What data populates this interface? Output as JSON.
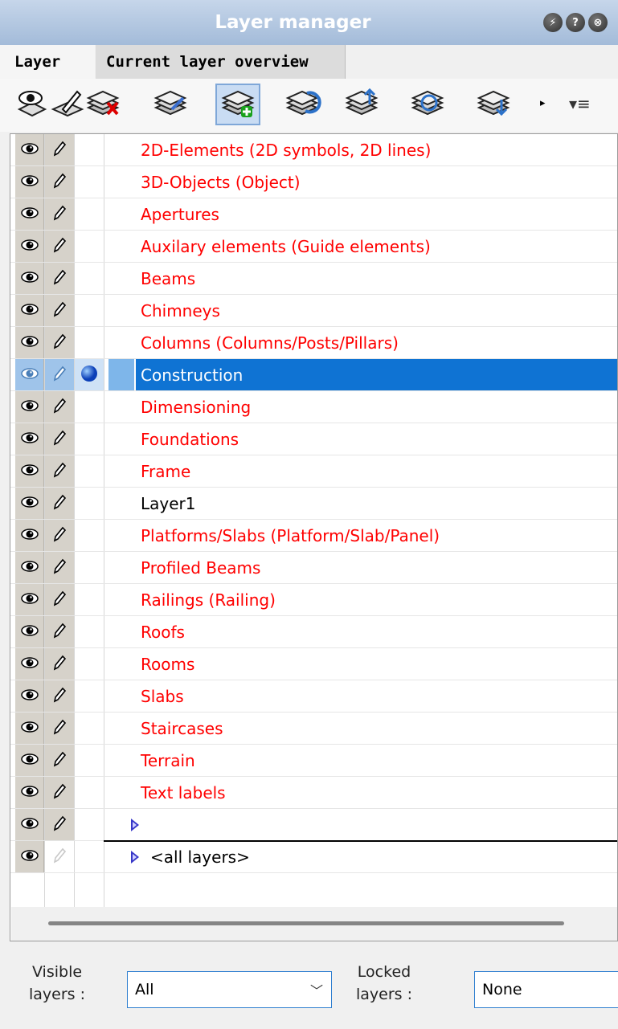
{
  "window": {
    "title": "Layer manager",
    "title_buttons": [
      {
        "name": "pin-button",
        "glyph": "⚡"
      },
      {
        "name": "help-button",
        "glyph": "?"
      },
      {
        "name": "close-button",
        "glyph": "⊗"
      }
    ]
  },
  "tabs": [
    {
      "label": "Layer",
      "active": true
    },
    {
      "label": "Current layer overview",
      "active": false
    }
  ],
  "toolbar": {
    "tools": [
      {
        "name": "show-layer-tool",
        "icon": "eye-icon"
      },
      {
        "name": "edit-layer-tool",
        "icon": "pencil-icon"
      },
      {
        "name": "delete-layer-tool",
        "icon": "delete-layer-icon"
      },
      {
        "name": "edit-properties-tool",
        "icon": "layer-edit-icon"
      },
      {
        "name": "new-layer-tool",
        "icon": "new-layer-icon",
        "selected": true
      },
      {
        "name": "rotate-layer-tool",
        "icon": "layer-rotate-icon"
      },
      {
        "name": "move-up-tool",
        "icon": "layer-up-icon"
      },
      {
        "name": "refresh-layer-tool",
        "icon": "layer-refresh-icon"
      },
      {
        "name": "move-down-tool",
        "icon": "layer-down-icon"
      }
    ],
    "more_glyph": "▸",
    "menu_glyph": "▾≡"
  },
  "layers": [
    {
      "name": "2D-Elements (2D symbols, 2D lines)",
      "color": "#ff0000"
    },
    {
      "name": "3D-Objects (Object)",
      "color": "#ff0000"
    },
    {
      "name": "Apertures",
      "color": "#ff0000"
    },
    {
      "name": "Auxilary elements (Guide elements)",
      "color": "#ff0000"
    },
    {
      "name": "Beams",
      "color": "#ff0000"
    },
    {
      "name": "Chimneys",
      "color": "#ff0000"
    },
    {
      "name": "Columns (Columns/Posts/Pillars)",
      "color": "#ff0000"
    },
    {
      "name": "Construction",
      "color": "#ffffff",
      "selected": true,
      "active": true
    },
    {
      "name": "Dimensioning",
      "color": "#ff0000"
    },
    {
      "name": "Foundations",
      "color": "#ff0000"
    },
    {
      "name": "Frame",
      "color": "#ff0000"
    },
    {
      "name": "Layer1",
      "color": "#000000"
    },
    {
      "name": "Platforms/Slabs (Platform/Slab/Panel)",
      "color": "#ff0000"
    },
    {
      "name": "Profiled Beams",
      "color": "#ff0000"
    },
    {
      "name": "Railings (Railing)",
      "color": "#ff0000"
    },
    {
      "name": "Roofs",
      "color": "#ff0000"
    },
    {
      "name": "Rooms",
      "color": "#ff0000"
    },
    {
      "name": "Slabs",
      "color": "#ff0000"
    },
    {
      "name": "Staircases",
      "color": "#ff0000"
    },
    {
      "name": "Terrain",
      "color": "#ff0000"
    },
    {
      "name": "Text labels",
      "color": "#ff0000"
    }
  ],
  "group_rows": [
    {
      "label": "",
      "expander": true
    },
    {
      "label": "<all layers>",
      "expander": true,
      "pen_disabled": true
    }
  ],
  "footer": {
    "visible_label_line1": "Visible",
    "visible_label_line2": "layers :",
    "visible_value": "All",
    "locked_label_line1": "Locked",
    "locked_label_line2": "layers :",
    "locked_value": "None"
  }
}
